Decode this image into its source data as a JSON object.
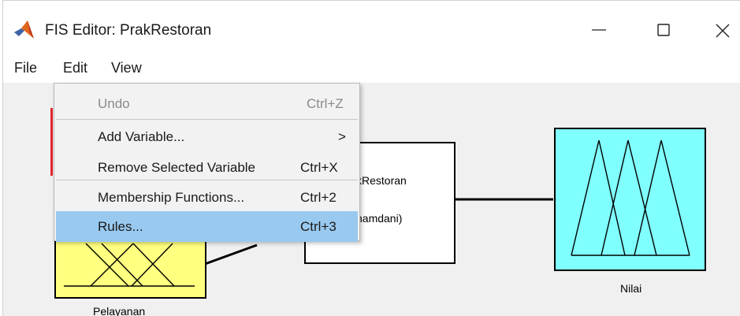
{
  "window": {
    "title": "FIS Editor: PrakRestoran",
    "icon": "matlab-icon",
    "controls": [
      "minimize-icon",
      "maximize-icon",
      "close-icon"
    ]
  },
  "menubar": {
    "file": "File",
    "edit": "Edit",
    "view": "View"
  },
  "edit_menu": {
    "items": [
      {
        "label": "Undo",
        "shortcut": "Ctrl+Z",
        "enabled": false
      },
      {
        "label": "Add Variable...",
        "shortcut": ">",
        "submenu": true
      },
      {
        "label": "Remove Selected Variable",
        "shortcut": "Ctrl+X"
      },
      {
        "label": "Membership Functions...",
        "shortcut": "Ctrl+2"
      },
      {
        "label": "Rules...",
        "shortcut": "Ctrl+3",
        "highlighted": true
      }
    ]
  },
  "diagram": {
    "input_label": "Pelayanan",
    "system_name_partial": "kRestoran",
    "system_type_partial": "namdani)",
    "output_label": "Nilai"
  },
  "colors": {
    "input_block": "#ffff80",
    "output_block": "#80ffff",
    "menu_highlight": "#99c9ef"
  }
}
